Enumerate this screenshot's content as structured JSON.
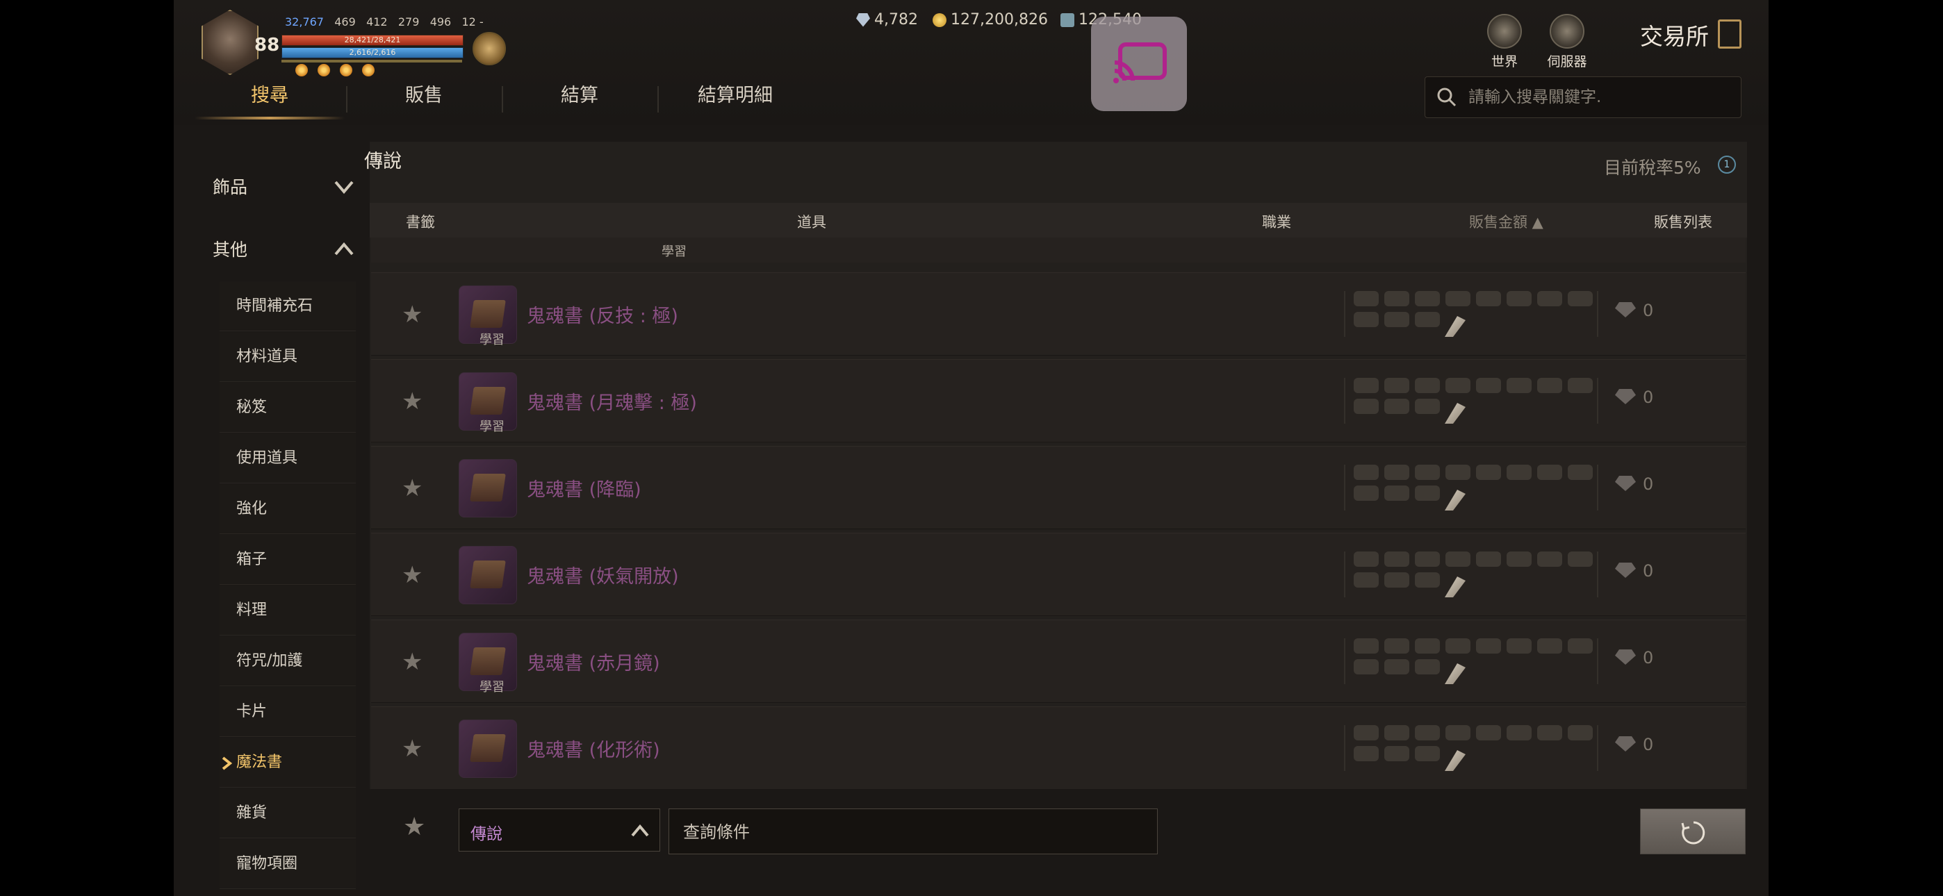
{
  "player": {
    "level": "88",
    "stats": [
      "32,767",
      "469",
      "412",
      "279",
      "496",
      "12 -"
    ],
    "hp_text": "28,421/28,421",
    "mp_text": "2,616/2,616"
  },
  "currency": {
    "diamonds": "4,782",
    "gold": "127,200,826",
    "tokens": "122,540"
  },
  "header": {
    "world_label": "世界",
    "server_label": "伺服器",
    "title": "交易所"
  },
  "tabs": [
    "搜尋",
    "販售",
    "結算",
    "結算明細"
  ],
  "search": {
    "placeholder": "請輸入搜尋關鍵字."
  },
  "sidebar": {
    "categories": [
      {
        "label": "飾品",
        "expanded": false
      },
      {
        "label": "其他",
        "expanded": true
      }
    ],
    "items": [
      "時間補充石",
      "材料道具",
      "秘笈",
      "使用道具",
      "強化",
      "箱子",
      "料理",
      "符咒/加護",
      "卡片",
      "魔法書",
      "雜貨",
      "寵物項圈"
    ],
    "active_item": "魔法書"
  },
  "panel": {
    "title": "傳說",
    "tax": "目前稅率5%",
    "tax_icon": "1",
    "columns": {
      "bookmark": "書籤",
      "item": "道具",
      "class": "職業",
      "price": "販售金額 ▲",
      "list": "販售列表"
    },
    "partial_row_learn": "學習"
  },
  "rows": [
    {
      "name": "鬼魂書 (反技 : 極)",
      "learn": "學習",
      "price": "0",
      "count": "0"
    },
    {
      "name": "鬼魂書 (月魂擊 : 極)",
      "learn": "學習",
      "price": "0",
      "count": "0"
    },
    {
      "name": "鬼魂書 (降臨)",
      "learn": "",
      "price": "0",
      "count": "0"
    },
    {
      "name": "鬼魂書 (妖氣開放)",
      "learn": "",
      "price": "0",
      "count": "0"
    },
    {
      "name": "鬼魂書 (赤月鏡)",
      "learn": "學習",
      "price": "0",
      "count": "0"
    },
    {
      "name": "鬼魂書 (化形術)",
      "learn": "",
      "price": "0",
      "count": "0"
    }
  ],
  "filter": {
    "grade": "傳說",
    "condition_placeholder": "查詢條件"
  },
  "icons": {
    "search": "search-icon",
    "star": "star-icon",
    "cast": "cast-icon",
    "refresh": "refresh-icon",
    "chevron": "chevron-icon"
  },
  "colors": {
    "accent": "#f2c46a",
    "legendary_item": "#8a4f83",
    "grade_text": "#c68ad4",
    "cast_overlay": "#b0238c"
  }
}
